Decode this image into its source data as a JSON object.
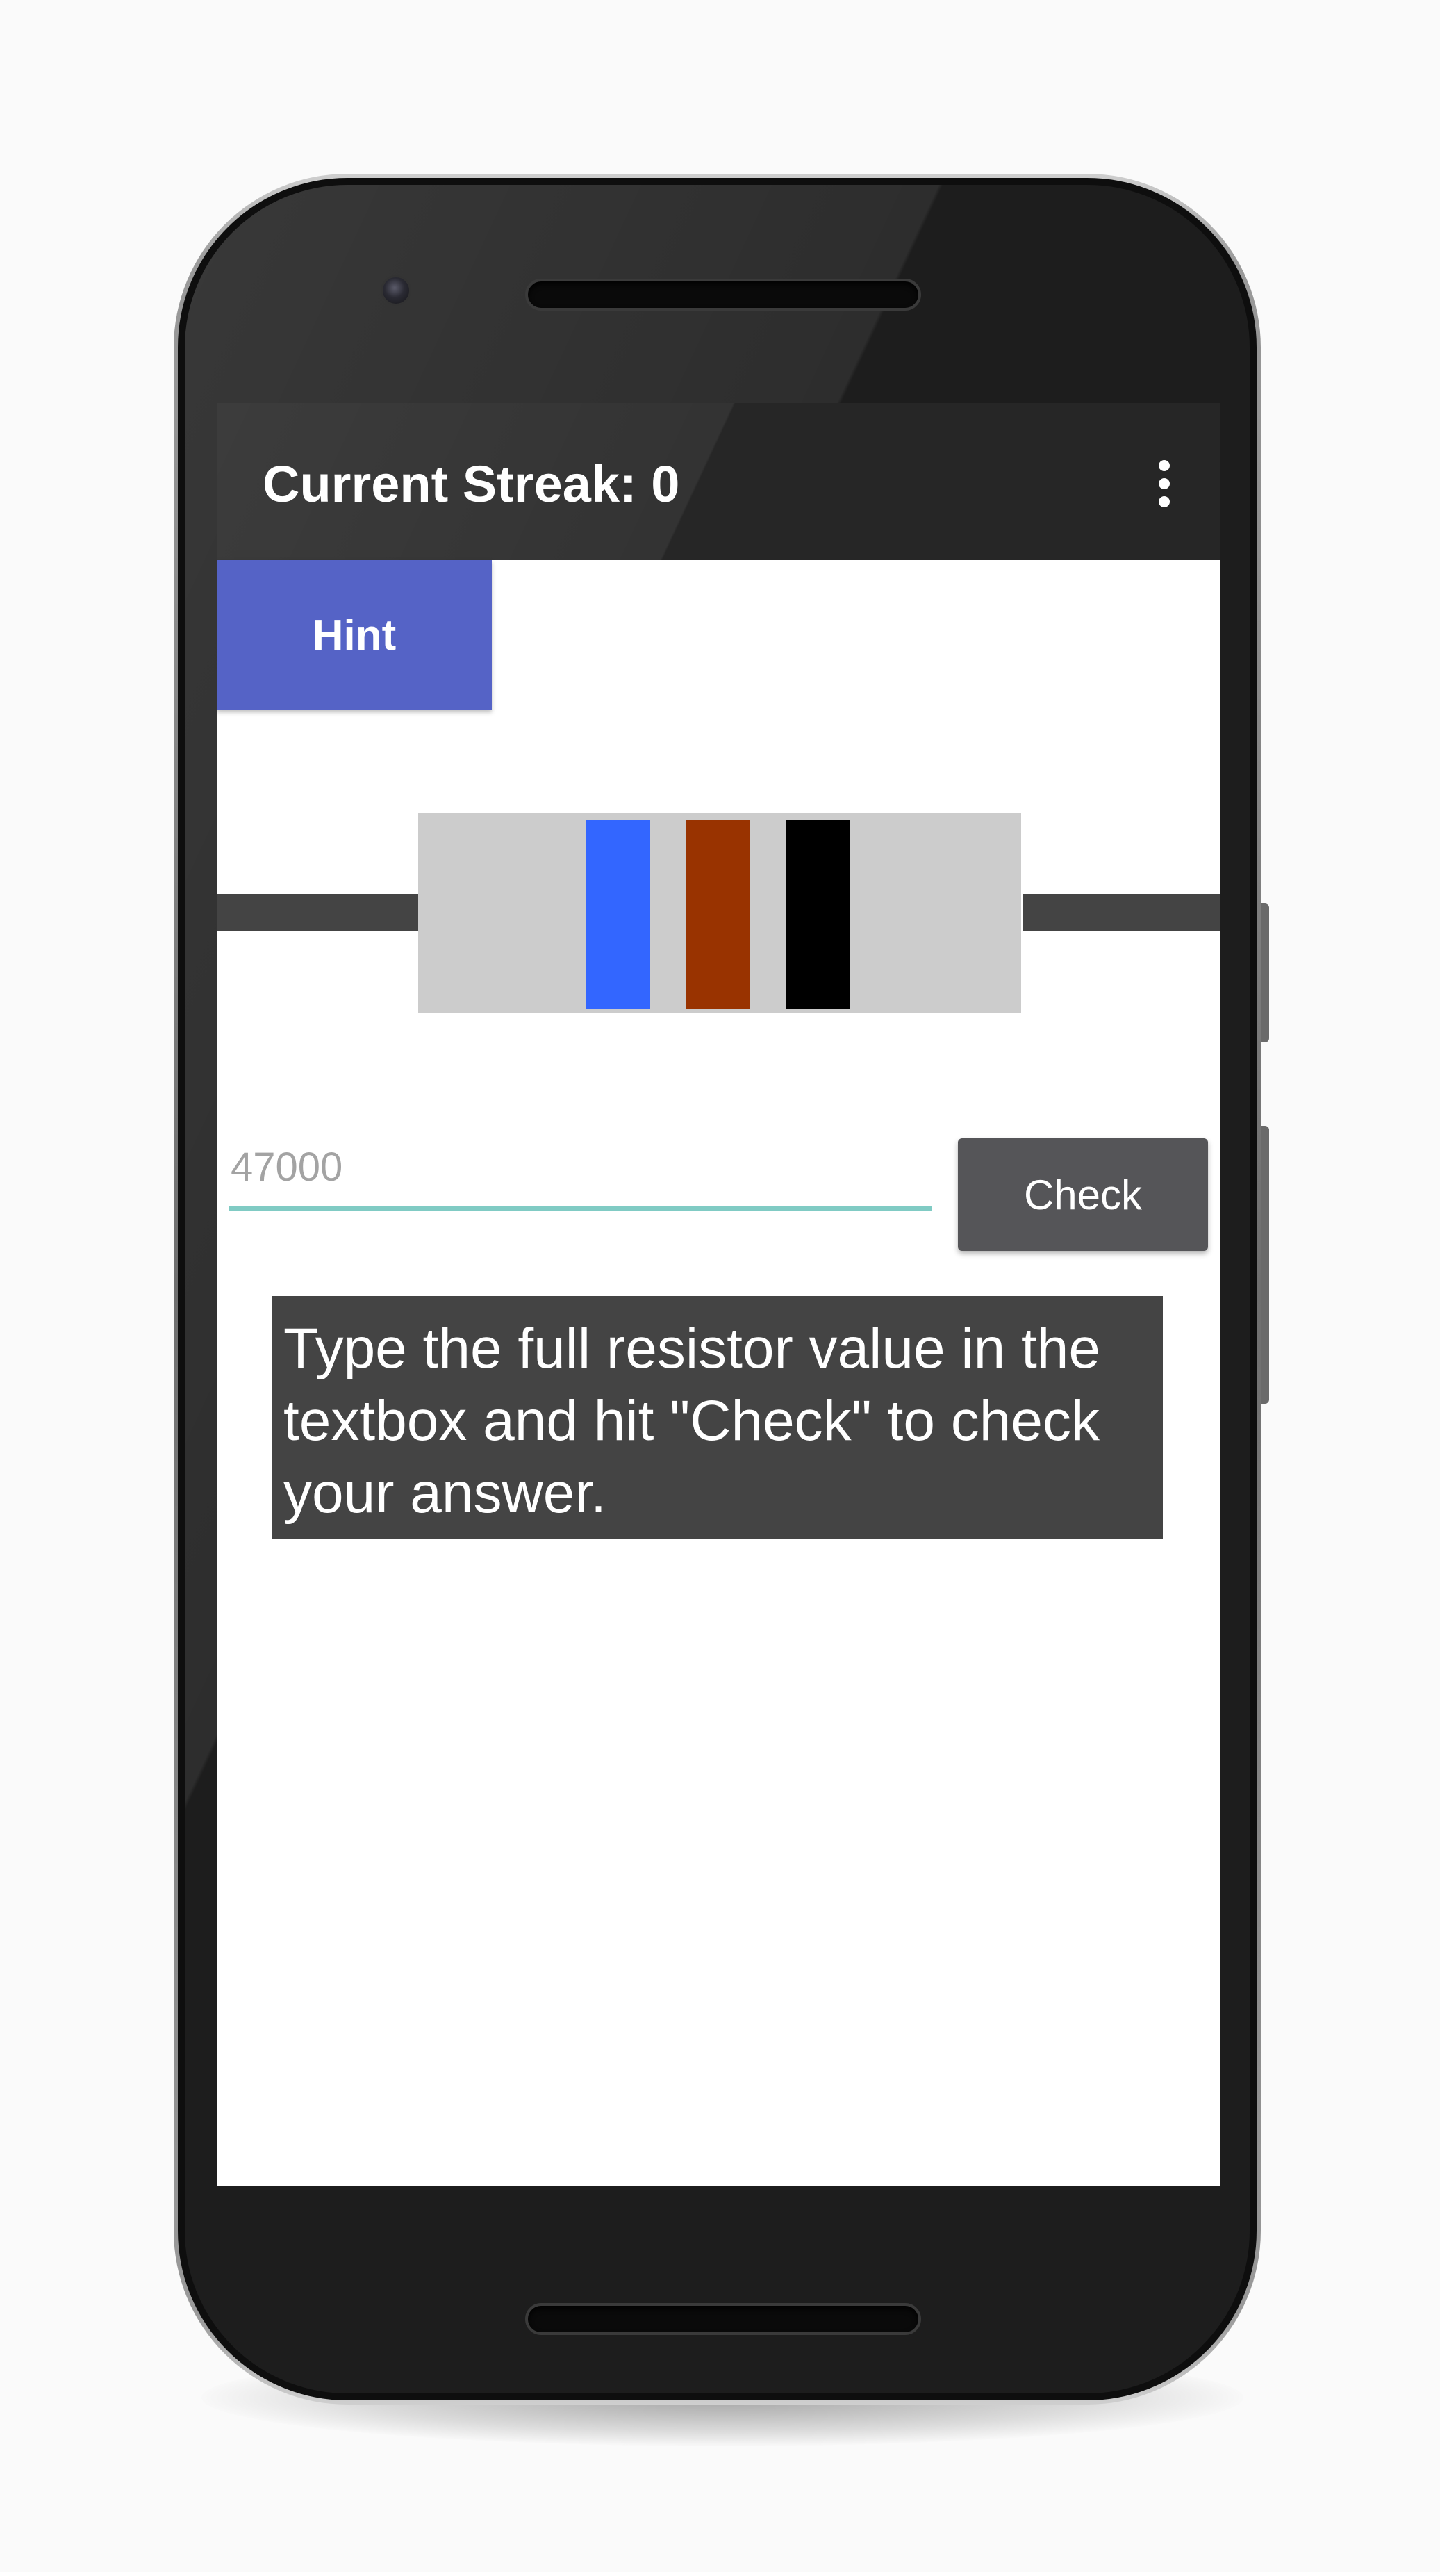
{
  "app_bar": {
    "title": "Current Streak: 0",
    "overflow_icon": "more-vert-icon"
  },
  "hint_button": {
    "label": "Hint",
    "color": "#5563c6"
  },
  "resistor": {
    "body_color": "#cccccc",
    "lead_color": "#444444",
    "bands": [
      {
        "name": "blue",
        "color": "#3366ff"
      },
      {
        "name": "brown",
        "color": "#993300"
      },
      {
        "name": "black",
        "color": "#000000"
      }
    ]
  },
  "answer_input": {
    "value": "",
    "placeholder": "47000",
    "underline_color": "#80cbc4"
  },
  "check_button": {
    "label": "Check"
  },
  "instructions": {
    "text": "Type the full resistor value in the textbox and hit \"Check\" to check your answer."
  }
}
